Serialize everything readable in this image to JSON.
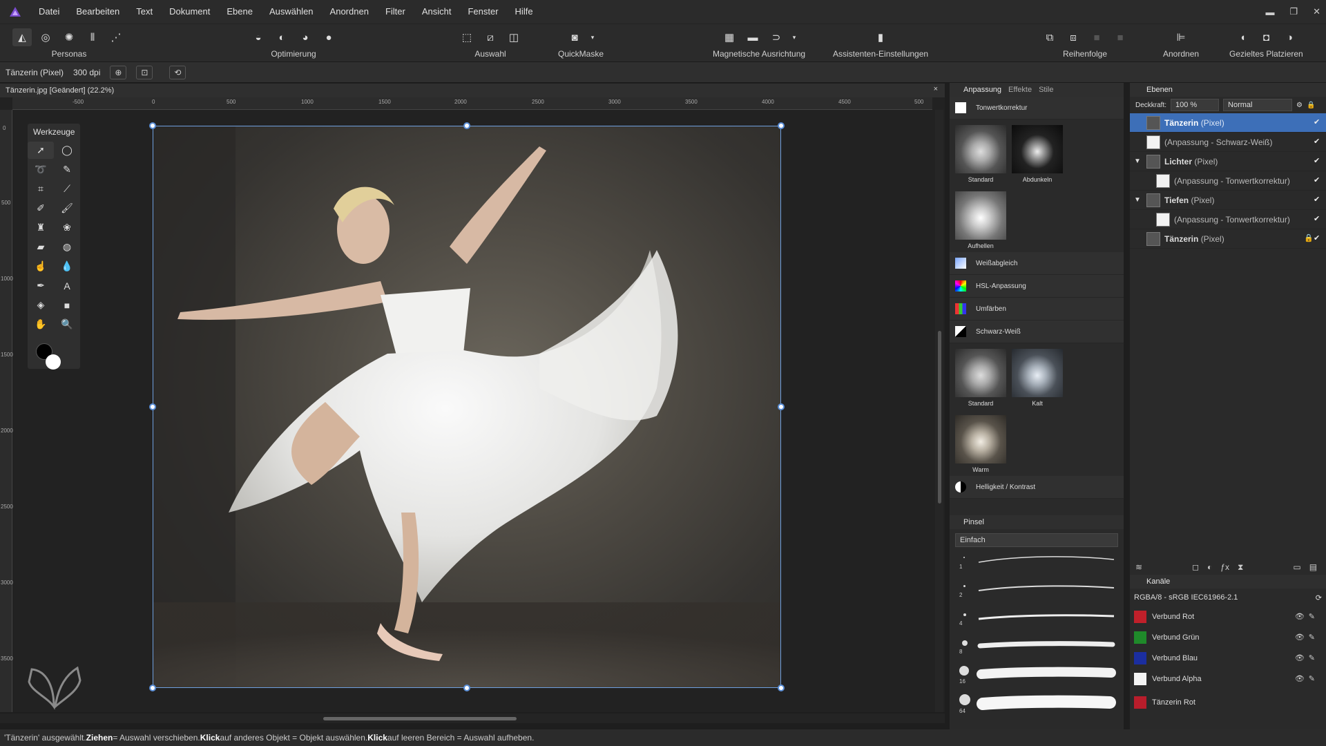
{
  "menu": [
    "Datei",
    "Bearbeiten",
    "Text",
    "Dokument",
    "Ebene",
    "Auswählen",
    "Anordnen",
    "Filter",
    "Ansicht",
    "Fenster",
    "Hilfe"
  ],
  "toolbar": {
    "personas": "Personas",
    "optimierung": "Optimierung",
    "auswahl": "Auswahl",
    "quickmaske": "QuickMaske",
    "magnetisch": "Magnetische Ausrichtung",
    "assistent": "Assistenten-Einstellungen",
    "reihenfolge": "Reihenfolge",
    "anordnen": "Anordnen",
    "platzieren": "Gezieltes Platzieren"
  },
  "context": {
    "layer": "Tänzerin (Pixel)",
    "dpi": "300 dpi"
  },
  "document": {
    "tab": "Tänzerin.jpg [Geändert] (22.2%)",
    "close": "×"
  },
  "ruler_h": [
    "-500",
    "0",
    "500",
    "1000",
    "1500",
    "2000",
    "2500",
    "3000",
    "3500",
    "4000",
    "4500",
    "500"
  ],
  "ruler_v": [
    "0",
    "500",
    "1000",
    "1500",
    "2000",
    "2500",
    "3000",
    "3500"
  ],
  "tools": {
    "title": "Werkzeuge"
  },
  "adjustment": {
    "tabs": [
      "Anpassung",
      "Effekte",
      "Stile"
    ],
    "tonwert": "Tonwertkorrektur",
    "t1": [
      "Standard",
      "Abdunkeln"
    ],
    "t2": [
      "Aufhellen"
    ],
    "items": [
      "Weißabgleich",
      "HSL-Anpassung",
      "Umfärben",
      "Schwarz-Weiß"
    ],
    "t3": [
      "Standard",
      "Kalt"
    ],
    "t4": [
      "Warm"
    ],
    "helligkeit": "Helligkeit / Kontrast"
  },
  "brushes": {
    "title": "Pinsel",
    "category": "Einfach",
    "sizes": [
      "1",
      "2",
      "4",
      "8",
      "16",
      "64"
    ]
  },
  "layers": {
    "title": "Ebenen",
    "opacity_label": "Deckkraft:",
    "opacity": "100 %",
    "blend": "Normal",
    "rows": [
      {
        "name": "Tänzerin",
        "type": "(Pixel)"
      },
      {
        "name": "",
        "type": "(Anpassung - Schwarz-Weiß)"
      },
      {
        "name": "Lichter",
        "type": "(Pixel)"
      },
      {
        "name": "",
        "type": "(Anpassung - Tonwertkorrektur)"
      },
      {
        "name": "Tiefen",
        "type": "(Pixel)"
      },
      {
        "name": "",
        "type": "(Anpassung - Tonwertkorrektur)"
      },
      {
        "name": "Tänzerin",
        "type": "(Pixel)"
      }
    ]
  },
  "channels": {
    "title": "Kanäle",
    "format": "RGBA/8 - sRGB IEC61966-2.1",
    "rows": [
      "Verbund Rot",
      "Verbund Grün",
      "Verbund Blau",
      "Verbund Alpha",
      "Tänzerin Rot"
    ]
  },
  "status": {
    "p1": "'Tänzerin' ausgewählt. ",
    "b1": "Ziehen",
    "p2": " = Auswahl verschieben. ",
    "b2": "Klick",
    "p3": " auf anderes Objekt = Objekt auswählen. ",
    "b3": "Klick",
    "p4": " auf leeren Bereich = Auswahl aufheben."
  },
  "colors": {
    "accent": "#3d6fb8",
    "selection": "#5b8fd8",
    "logo": "#7b4ccf"
  }
}
